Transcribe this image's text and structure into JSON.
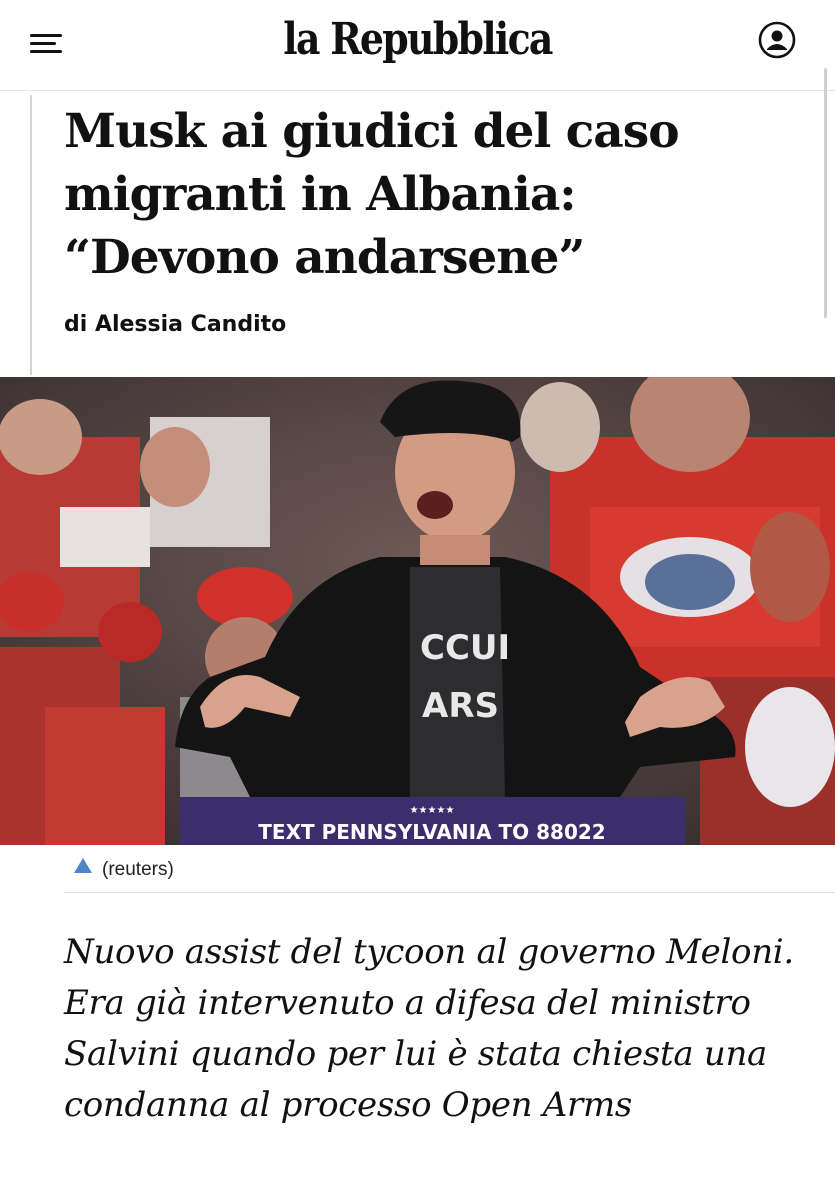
{
  "header": {
    "logo": "la Repubblica",
    "menu_icon": "hamburger-menu-icon",
    "account_icon": "user-account-icon"
  },
  "article": {
    "headline": "Musk ai giudici del caso migranti in Albania: “Devono andarsene”",
    "byline": "di Alessia Candito",
    "photo": {
      "banner_text": "TEXT PENNSYLVANIA TO 88022",
      "shirt_text": "CCUI ARS",
      "banner_stars": "★★★★★",
      "credit": "(reuters)",
      "credit_icon": "expand-caption-icon"
    },
    "summary": "Nuovo assist del tycoon al governo Meloni. Era già intervenuto a difesa del ministro Salvini quando per lui è stata chiesta una condanna al processo Open Arms"
  },
  "colors": {
    "accent": "#4a86c8",
    "text": "#111111",
    "crowd_red": "#c8322b",
    "banner_purple": "#3b2d6e"
  }
}
